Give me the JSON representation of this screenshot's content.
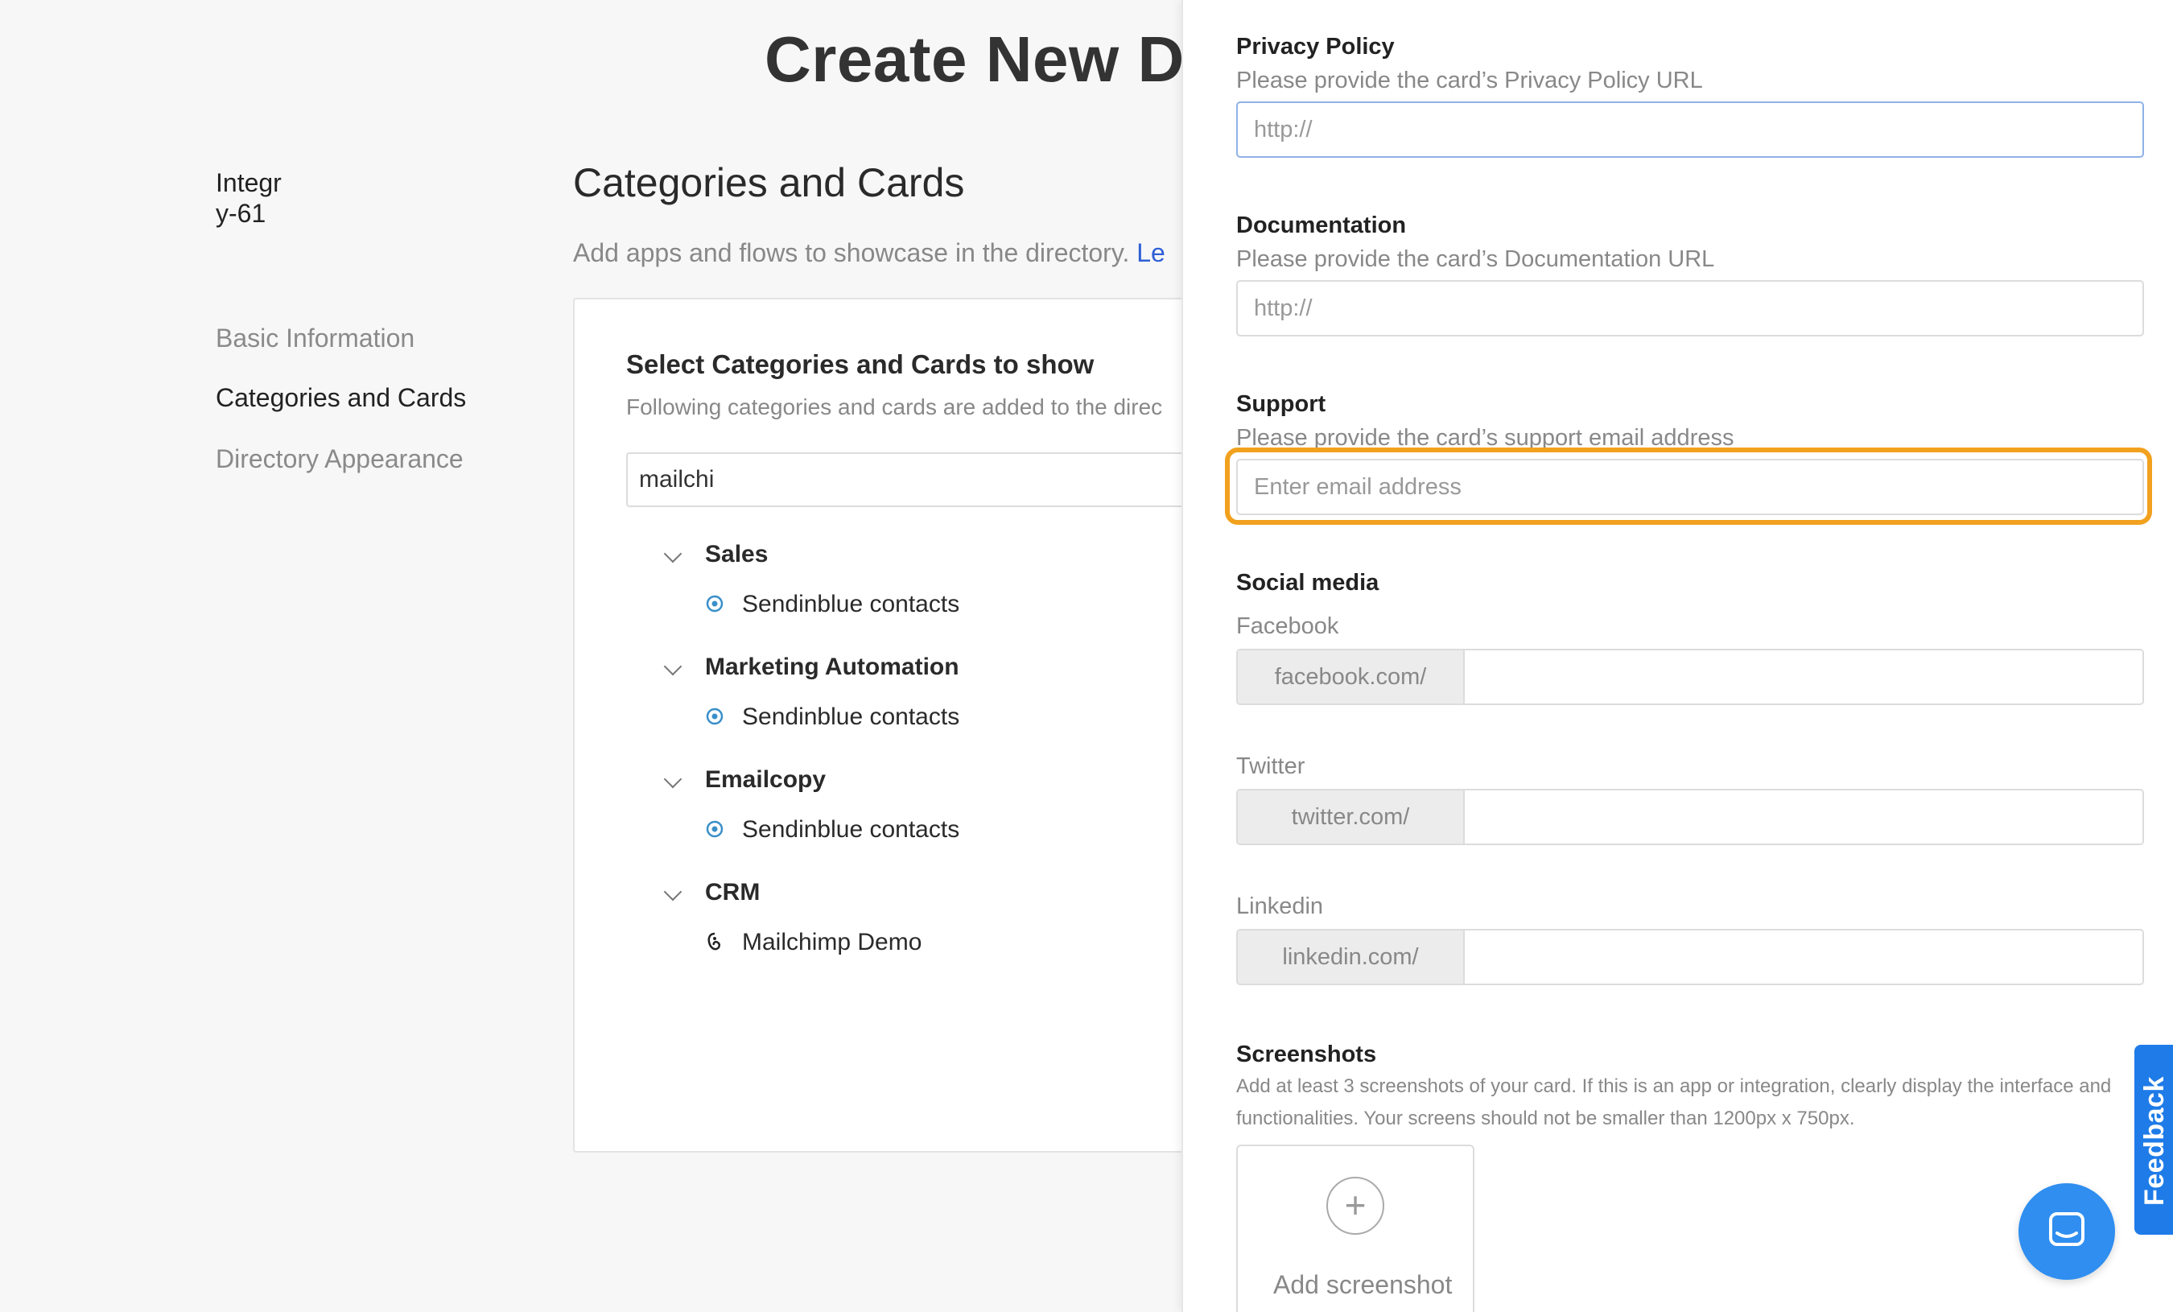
{
  "page": {
    "title": "Create New Dir"
  },
  "sidebar": {
    "header": [
      "Integr",
      "y-61"
    ],
    "items": [
      {
        "label": "Basic Information",
        "active": false
      },
      {
        "label": "Categories and Cards",
        "active": true
      },
      {
        "label": "Directory Appearance",
        "active": false
      }
    ]
  },
  "main": {
    "section_title": "Categories and Cards",
    "section_desc": "Add apps and flows to showcase in the directory.",
    "section_link": "Le",
    "panel": {
      "title": "Select Categories and Cards to show",
      "desc": "Following categories and cards are added to the direc",
      "search_value": "mailchi",
      "categories": [
        {
          "name": "Sales",
          "cards": [
            {
              "name": "Sendinblue contacts",
              "icon": "sendinblue-icon"
            }
          ]
        },
        {
          "name": "Marketing Automation",
          "cards": [
            {
              "name": "Sendinblue contacts",
              "icon": "sendinblue-icon"
            }
          ]
        },
        {
          "name": "Emailcopy",
          "cards": [
            {
              "name": "Sendinblue contacts",
              "icon": "sendinblue-icon"
            }
          ]
        },
        {
          "name": "CRM",
          "cards": [
            {
              "name": "Mailchimp Demo",
              "icon": "mailchimp-icon"
            }
          ]
        }
      ]
    }
  },
  "drawer": {
    "privacy": {
      "label": "Privacy Policy",
      "sub": "Please provide the card’s Privacy Policy URL",
      "placeholder": "http://"
    },
    "documentation": {
      "label": "Documentation",
      "sub": "Please provide the card’s Documentation URL",
      "placeholder": "http://"
    },
    "support": {
      "label": "Support",
      "sub": "Please provide the card’s support email address",
      "placeholder": "Enter email address"
    },
    "social": {
      "label": "Social media",
      "facebook": {
        "label": "Facebook",
        "prefix": "facebook.com/"
      },
      "twitter": {
        "label": "Twitter",
        "prefix": "twitter.com/"
      },
      "linkedin": {
        "label": "Linkedin",
        "prefix": "linkedin.com/"
      }
    },
    "screenshots": {
      "label": "Screenshots",
      "desc": "Add at least 3 screenshots of your card. If this is an app or integration, clearly display the interface and functionalities. Your screens should not be smaller than 1200px x 750px.",
      "add_label": "Add screenshot"
    }
  },
  "widgets": {
    "feedback": "Feedback"
  },
  "colors": {
    "highlight": "#f2a11f",
    "accent": "#1e7be8",
    "link": "#2f5fd6"
  }
}
